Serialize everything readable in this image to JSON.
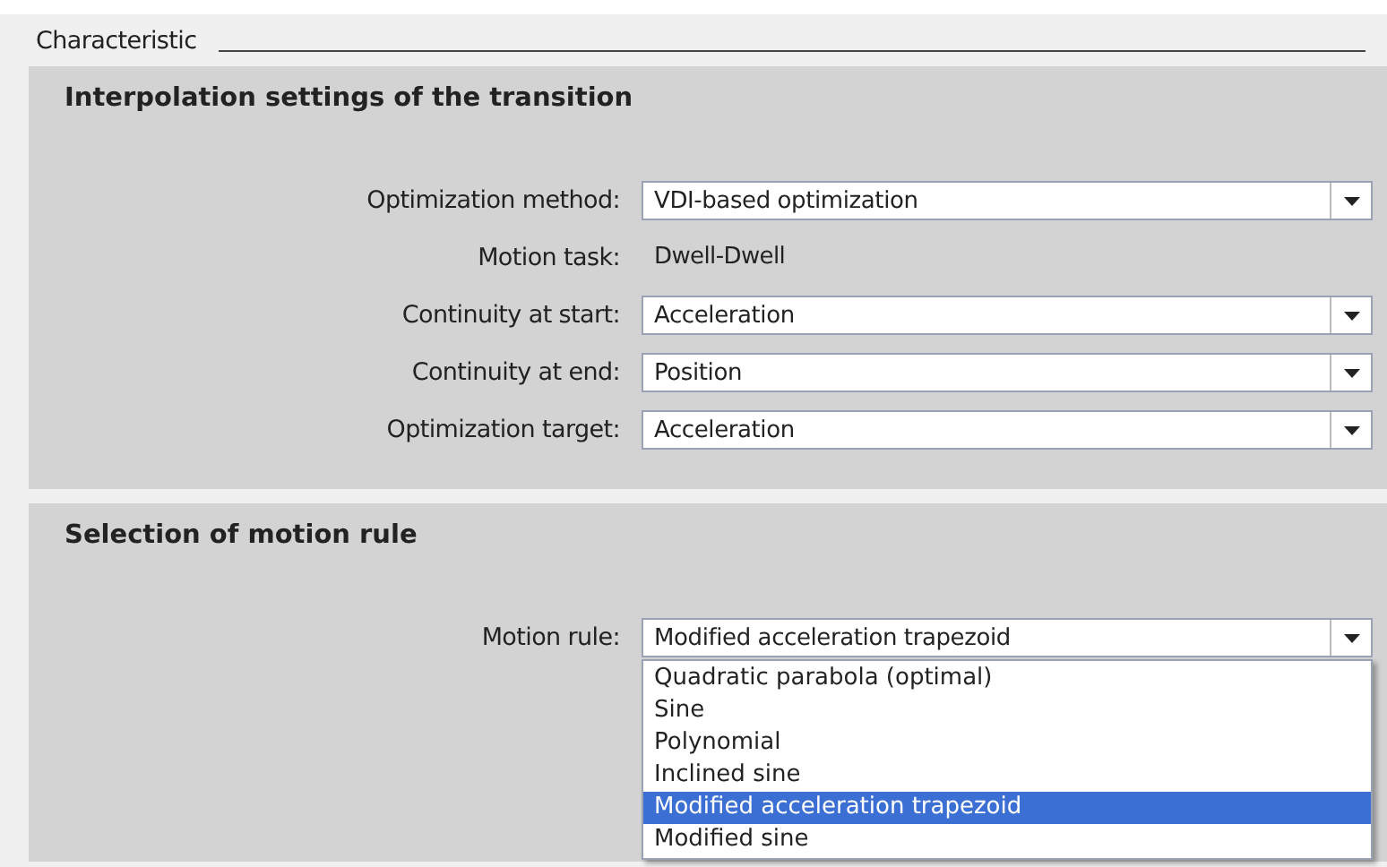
{
  "section_title": "Characteristic",
  "interpolation": {
    "title": "Interpolation settings of the transition",
    "fields": [
      {
        "label": "Optimization method:",
        "kind": "dropdown",
        "value": "VDI-based optimization"
      },
      {
        "label": "Motion task:",
        "kind": "text",
        "value": "Dwell-Dwell"
      },
      {
        "label": "Continuity at start:",
        "kind": "dropdown",
        "value": "Acceleration"
      },
      {
        "label": "Continuity at end:",
        "kind": "dropdown",
        "value": "Position"
      },
      {
        "label": "Optimization target:",
        "kind": "dropdown",
        "value": "Acceleration"
      }
    ]
  },
  "motion_rule": {
    "title": "Selection of motion rule",
    "label": "Motion rule:",
    "value": "Modified acceleration trapezoid",
    "options": [
      {
        "label": "Quadratic parabola (optimal)",
        "selected": false
      },
      {
        "label": "Sine",
        "selected": false
      },
      {
        "label": "Polynomial",
        "selected": false
      },
      {
        "label": "Inclined sine",
        "selected": false
      },
      {
        "label": "Modified acceleration trapezoid",
        "selected": true
      },
      {
        "label": "Modified sine",
        "selected": false
      }
    ]
  }
}
